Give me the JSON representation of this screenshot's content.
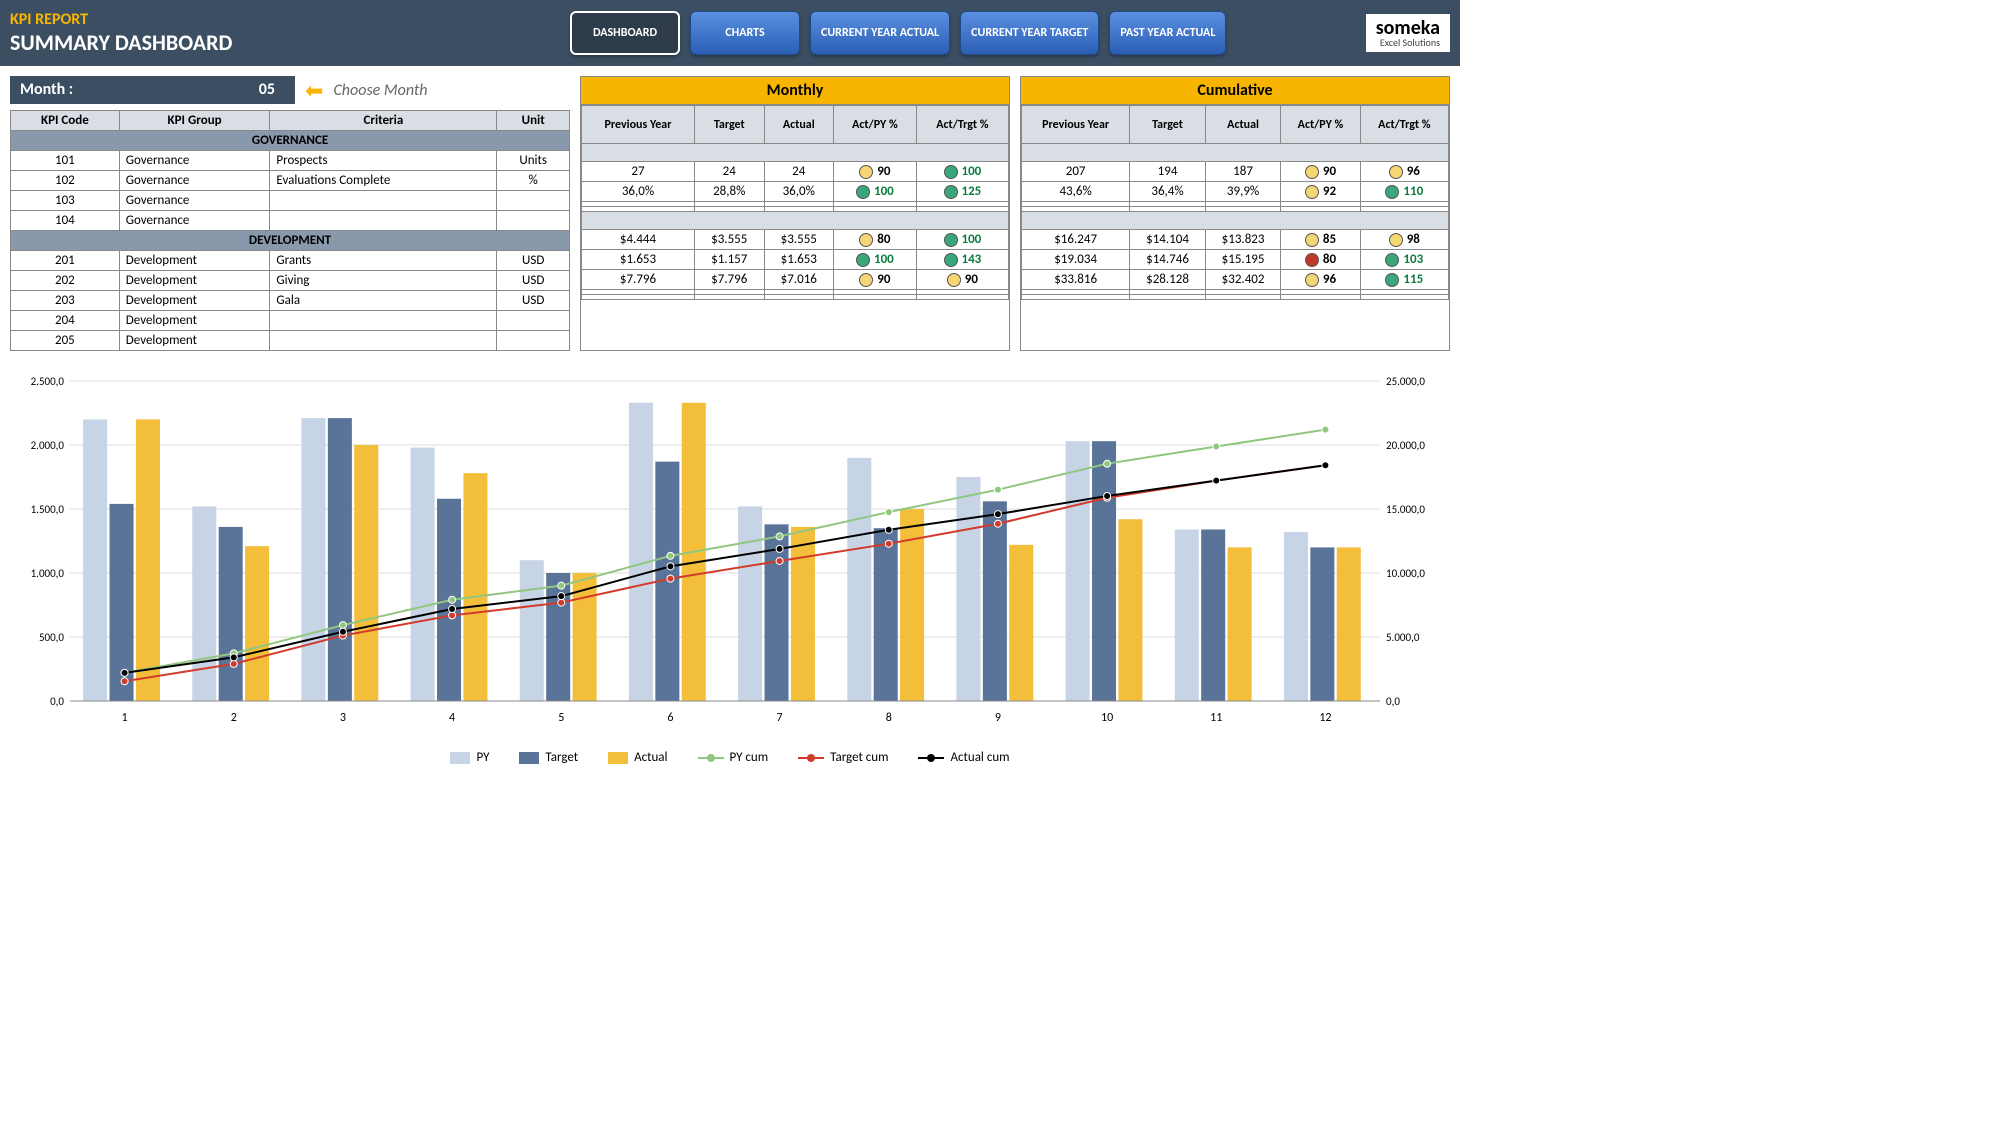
{
  "header": {
    "title": "KPI REPORT",
    "subtitle": "SUMMARY DASHBOARD",
    "nav": [
      "DASHBOARD",
      "CHARTS",
      "CURRENT YEAR ACTUAL",
      "CURRENT YEAR TARGET",
      "PAST YEAR ACTUAL"
    ],
    "logo": "someka",
    "logo_sub": "Excel Solutions"
  },
  "month": {
    "label": "Month :",
    "value": "05",
    "hint": "Choose Month"
  },
  "left_headers": [
    "KPI Code",
    "KPI Group",
    "Criteria",
    "Unit"
  ],
  "groups": [
    "GOVERNANCE",
    "DEVELOPMENT"
  ],
  "rows": [
    {
      "code": "101",
      "group": "Governance",
      "criteria": "Prospects",
      "unit": "Units",
      "section": 0
    },
    {
      "code": "102",
      "group": "Governance",
      "criteria": "Evaluations Complete",
      "unit": "%",
      "section": 0
    },
    {
      "code": "103",
      "group": "Governance",
      "criteria": "",
      "unit": "",
      "section": 0
    },
    {
      "code": "104",
      "group": "Governance",
      "criteria": "",
      "unit": "",
      "section": 0
    },
    {
      "code": "201",
      "group": "Development",
      "criteria": "Grants",
      "unit": "USD",
      "section": 1
    },
    {
      "code": "202",
      "group": "Development",
      "criteria": "Giving",
      "unit": "USD",
      "section": 1
    },
    {
      "code": "203",
      "group": "Development",
      "criteria": "Gala",
      "unit": "USD",
      "section": 1
    },
    {
      "code": "204",
      "group": "Development",
      "criteria": "",
      "unit": "",
      "section": 1
    },
    {
      "code": "205",
      "group": "Development",
      "criteria": "",
      "unit": "",
      "section": 1
    }
  ],
  "block_titles": [
    "Monthly",
    "Cumulative"
  ],
  "block_headers": [
    "Previous Year",
    "Target",
    "Actual",
    "Act/PY %",
    "Act/Trgt %"
  ],
  "monthly": [
    {
      "py": "27",
      "target": "24",
      "actual": "24",
      "actpy": "90",
      "actpy_c": "yellow",
      "acttrgt": "100",
      "acttrgt_c": "green"
    },
    {
      "py": "36,0%",
      "target": "28,8%",
      "actual": "36,0%",
      "actpy": "100",
      "actpy_c": "green",
      "acttrgt": "125",
      "acttrgt_c": "green"
    },
    null,
    null,
    {
      "py": "$4.444",
      "target": "$3.555",
      "actual": "$3.555",
      "actpy": "80",
      "actpy_c": "yellow",
      "acttrgt": "100",
      "acttrgt_c": "green"
    },
    {
      "py": "$1.653",
      "target": "$1.157",
      "actual": "$1.653",
      "actpy": "100",
      "actpy_c": "green",
      "acttrgt": "143",
      "acttrgt_c": "green"
    },
    {
      "py": "$7.796",
      "target": "$7.796",
      "actual": "$7.016",
      "actpy": "90",
      "actpy_c": "yellow",
      "acttrgt": "90",
      "acttrgt_c": "yellow"
    },
    null,
    null
  ],
  "cumulative": [
    {
      "py": "207",
      "target": "194",
      "actual": "187",
      "actpy": "90",
      "actpy_c": "yellow",
      "acttrgt": "96",
      "acttrgt_c": "yellow"
    },
    {
      "py": "43,6%",
      "target": "36,4%",
      "actual": "39,9%",
      "actpy": "92",
      "actpy_c": "yellow",
      "acttrgt": "110",
      "acttrgt_c": "green"
    },
    null,
    null,
    {
      "py": "$16.247",
      "target": "$14.104",
      "actual": "$13.823",
      "actpy": "85",
      "actpy_c": "yellow",
      "acttrgt": "98",
      "acttrgt_c": "yellow"
    },
    {
      "py": "$19.034",
      "target": "$14.746",
      "actual": "$15.195",
      "actpy": "80",
      "actpy_c": "red",
      "acttrgt": "103",
      "acttrgt_c": "green"
    },
    {
      "py": "$33.816",
      "target": "$28.128",
      "actual": "$32.402",
      "actpy": "96",
      "actpy_c": "yellow",
      "acttrgt": "115",
      "acttrgt_c": "green"
    },
    null,
    null
  ],
  "chart_data": {
    "type": "bar+line",
    "categories": [
      1,
      2,
      3,
      4,
      5,
      6,
      7,
      8,
      9,
      10,
      11,
      12
    ],
    "ylabel_left_ticks": [
      "0,0",
      "500,0",
      "1.000,0",
      "1.500,0",
      "2.000,0",
      "2.500,0"
    ],
    "ylabel_right_ticks": [
      "0,0",
      "5.000,0",
      "10.000,0",
      "15.000,0",
      "20.000,0",
      "25.000,0"
    ],
    "ylim_left": [
      0,
      2500
    ],
    "ylim_right": [
      0,
      25000
    ],
    "series_bars": [
      {
        "name": "PY",
        "color": "#c7d4e6",
        "values": [
          2200,
          1520,
          2210,
          1980,
          1100,
          2330,
          1520,
          1900,
          1750,
          2030,
          1340,
          1320
        ]
      },
      {
        "name": "Target",
        "color": "#5a7398",
        "values": [
          1540,
          1360,
          2210,
          1580,
          1000,
          1870,
          1380,
          1350,
          1560,
          2030,
          1340,
          1200
        ]
      },
      {
        "name": "Actual",
        "color": "#f3be3a",
        "values": [
          2200,
          1210,
          2000,
          1780,
          1000,
          2330,
          1360,
          1500,
          1220,
          1420,
          1200,
          1200
        ]
      }
    ],
    "series_lines": [
      {
        "name": "PY cum",
        "color": "#8fc77f",
        "values": [
          2200,
          3720,
          5930,
          7910,
          9010,
          11340,
          12860,
          14760,
          16510,
          18540,
          19880,
          21200
        ]
      },
      {
        "name": "Target cum",
        "color": "#d23b2b",
        "values": [
          1540,
          2900,
          5110,
          6690,
          7690,
          9560,
          10940,
          12290,
          13850,
          15880,
          17220,
          18420
        ]
      },
      {
        "name": "Actual cum",
        "color": "#000000",
        "values": [
          2200,
          3410,
          5410,
          7190,
          8190,
          10520,
          11880,
          13380,
          14600,
          16020,
          17220,
          18420
        ]
      }
    ],
    "legend": [
      "PY",
      "Target",
      "Actual",
      "PY cum",
      "Target cum",
      "Actual cum"
    ]
  }
}
